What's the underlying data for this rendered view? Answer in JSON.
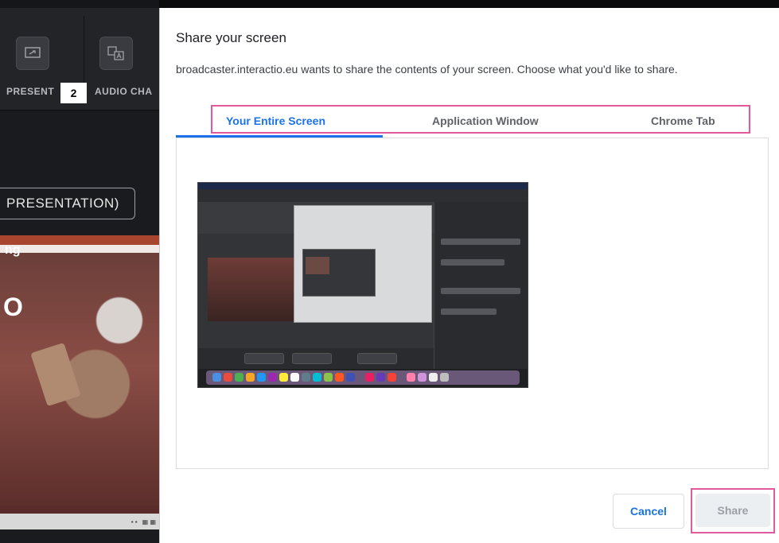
{
  "background_app": {
    "toolbar": {
      "present_label": "PRESENT",
      "audio_label": "AUDIO CHA",
      "badge": "2"
    },
    "presentation_chip": "PRESENTATION)",
    "slide": {
      "big_text": "O",
      "bottom_text": "ng"
    }
  },
  "dialog": {
    "title": "Share your screen",
    "description": "broadcaster.interactio.eu wants to share the contents of your screen. Choose what you'd like to share.",
    "tabs": [
      {
        "label": "Your Entire Screen",
        "active": true
      },
      {
        "label": "Application Window",
        "active": false
      },
      {
        "label": "Chrome Tab",
        "active": false
      }
    ],
    "buttons": {
      "cancel": "Cancel",
      "share": "Share"
    }
  },
  "colors": {
    "accent": "#1a73e8",
    "highlight": "#e35a9c"
  }
}
